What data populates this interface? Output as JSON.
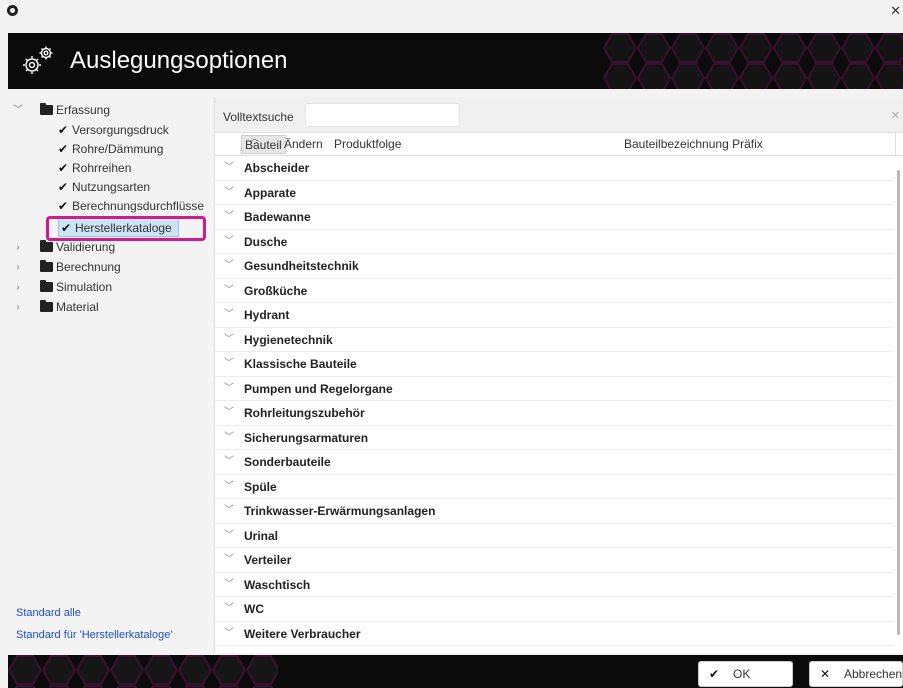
{
  "window": {
    "close_glyph": "✕"
  },
  "header": {
    "title": "Auslegungsoptionen",
    "icon": "gears-icon"
  },
  "tree": {
    "items": [
      {
        "label": "Erfassung",
        "type": "folder-open",
        "expanded": true
      },
      {
        "label": "Versorgungsdruck",
        "type": "check"
      },
      {
        "label": "Rohre/Dämmung",
        "type": "check"
      },
      {
        "label": "Rohrreihen",
        "type": "check"
      },
      {
        "label": "Nutzungsarten",
        "type": "check"
      },
      {
        "label": "Berechnungsdurchflüsse",
        "type": "check"
      },
      {
        "label": "Herstellerkataloge",
        "type": "check",
        "selected": true
      },
      {
        "label": "Validierung",
        "type": "folder"
      },
      {
        "label": "Berechnung",
        "type": "folder"
      },
      {
        "label": "Simulation",
        "type": "folder"
      },
      {
        "label": "Material",
        "type": "folder"
      }
    ],
    "links": {
      "standard_all": "Standard alle",
      "standard_current": "Standard für 'Herstellerkataloge'"
    }
  },
  "search": {
    "label": "Volltextsuche",
    "value": "",
    "placeholder": ""
  },
  "columns": {
    "bauteil": "Bauteil",
    "aendern": "Ändern",
    "produktfolge": "Produktfolge",
    "praefix": "Bauteilbezeichnung Präfix"
  },
  "groups": [
    "Abscheider",
    "Apparate",
    "Badewanne",
    "Dusche",
    "Gesundheitstechnik",
    "Großküche",
    "Hydrant",
    "Hygienetechnik",
    "Klassische Bauteile",
    "Pumpen und Regelorgane",
    "Rohrleitungszubehör",
    "Sicherungsarmaturen",
    "Sonderbauteile",
    "Spüle",
    "Trinkwasser-Erwärmungsanlagen",
    "Urinal",
    "Verteiler",
    "Waschtisch",
    "WC",
    "Weitere Verbraucher"
  ],
  "footer": {
    "ok_label": "OK",
    "cancel_label": "Abbrechen"
  },
  "colors": {
    "highlight": "#d11a8c",
    "link": "#1e4fc2",
    "header_bg": "#0b0b0b"
  }
}
